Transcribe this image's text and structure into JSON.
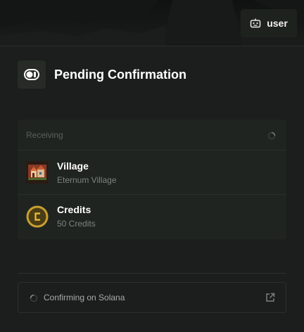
{
  "user_button": {
    "label": "user",
    "icon": "robot-icon"
  },
  "header": {
    "title": "Pending Confirmation",
    "icon": "pending-toggle-icon"
  },
  "receiving": {
    "title": "Receiving",
    "items": [
      {
        "name": "Village",
        "subtitle": "Eternum Village",
        "icon": "village-image"
      },
      {
        "name": "Credits",
        "subtitle": "50 Credits",
        "icon": "credits-coin-icon"
      }
    ]
  },
  "status": {
    "text": "Confirming on Solana",
    "icon": "external-link-icon"
  },
  "colors": {
    "background": "#1b1e1c",
    "card": "#202421",
    "coin": "#c8a030"
  }
}
